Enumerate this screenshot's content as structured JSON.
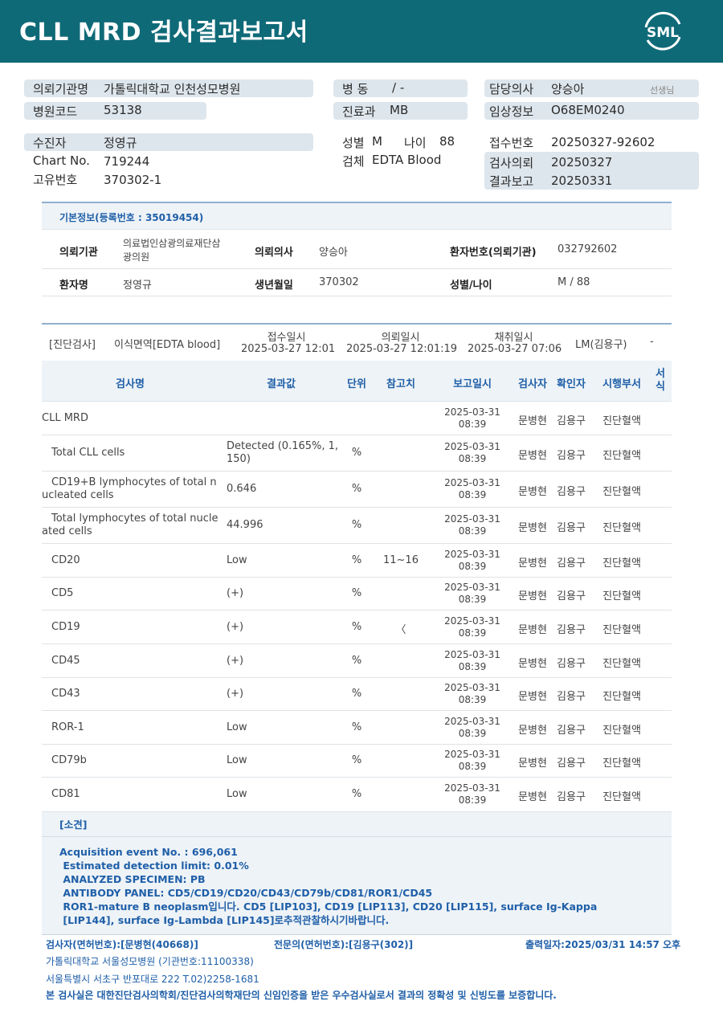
{
  "header": {
    "title": "CLL MRD 검사결과보고서",
    "logo_text": "SML"
  },
  "patient_block": {
    "req_org_label": "의뢰기관명",
    "req_org_value": "가톨릭대학교 인천성모병원",
    "hosp_code_label": "병원코드",
    "hosp_code_value": "53138",
    "ward_label": "병   동",
    "ward_value": "/ -",
    "dept_label": "진료과",
    "dept_value": "MB",
    "doctor_label": "담당의사",
    "doctor_value": "양승아",
    "doctor_suffix": "선생님",
    "clinical_label": "임상정보",
    "clinical_value": "O68EM0240",
    "patient_label": "수진자",
    "patient_value": "정영규",
    "chart_label": "Chart No.",
    "chart_value": "719244",
    "uid_label": "고유번호",
    "uid_value": "370302-1",
    "sex_label": "성별",
    "sex_value": "M",
    "age_label": "나이",
    "age_value": "88",
    "specimen_label": "검체",
    "specimen_value": "EDTA Blood",
    "receipt_label": "접수번호",
    "receipt_value": "20250327-92602",
    "request_label": "검사의뢰",
    "request_value": "20250327",
    "report_label": "결과보고",
    "report_value": "20250331"
  },
  "basic_info": {
    "title": "기본정보(등록번호 : 35019454)",
    "org_label": "의뢰기관",
    "org_value_1": "의료법인삼광의료재단삼",
    "org_value_2": "광의원",
    "doctor_label": "의뢰의사",
    "doctor_value": "양승아",
    "pid_label": "환자번호(의뢰기관)",
    "pid_value": "032792602",
    "name_label": "환자명",
    "name_value": "정영규",
    "dob_label": "생년월일",
    "dob_value": "370302",
    "sexage_label": "성별/나이",
    "sexage_value": "M / 88"
  },
  "test_info": {
    "category": "[진단검사]",
    "specimen": "이식면역[EDTA blood]",
    "receipt_label": "접수일시",
    "receipt_value": "2025-03-27 12:01",
    "request_label": "의뢰일시",
    "request_value": "2025-03-27 12:01:19",
    "collect_label": "채취일시",
    "collect_value": "2025-03-27 07:06",
    "lm": "LM(김용구)",
    "dash": "-"
  },
  "table": {
    "headers": {
      "name": "검사명",
      "result": "결과값",
      "unit": "단위",
      "ref": "참고치",
      "date": "보고일시",
      "tester": "검사자",
      "checker": "확인자",
      "dept": "시행부서",
      "form": "서식"
    },
    "rows": [
      {
        "name": "CLL MRD",
        "result": "",
        "unit": "",
        "ref": "",
        "date1": "2025-03-31",
        "date2": "08:39",
        "tester": "문병현",
        "checker": "김용구",
        "dept": "진단혈액"
      },
      {
        "name": "Total CLL cells",
        "result": "Detected (0.165%, 1,150)",
        "unit": "%",
        "ref": "",
        "date1": "2025-03-31",
        "date2": "08:39",
        "tester": "문병현",
        "checker": "김용구",
        "dept": "진단혈액"
      },
      {
        "name": "CD19+B lymphocytes of total nucleated cells",
        "result": "0.646",
        "unit": "%",
        "ref": "",
        "date1": "2025-03-31",
        "date2": "08:39",
        "tester": "문병현",
        "checker": "김용구",
        "dept": "진단혈액"
      },
      {
        "name": "Total lymphocytes of total nucleated cells",
        "result": "44.996",
        "unit": "%",
        "ref": "",
        "date1": "2025-03-31",
        "date2": "08:39",
        "tester": "문병현",
        "checker": "김용구",
        "dept": "진단혈액"
      },
      {
        "name": "CD20",
        "result": "Low",
        "unit": "%",
        "ref": "11~16",
        "date1": "2025-03-31",
        "date2": "08:39",
        "tester": "문병현",
        "checker": "김용구",
        "dept": "진단혈액"
      },
      {
        "name": "CD5",
        "result": "(+)",
        "unit": "%",
        "ref": "",
        "date1": "2025-03-31",
        "date2": "08:39",
        "tester": "문병현",
        "checker": "김용구",
        "dept": "진단혈액"
      },
      {
        "name": "CD19",
        "result": "(+)",
        "unit": "%",
        "ref": "〈",
        "date1": "2025-03-31",
        "date2": "08:39",
        "tester": "문병현",
        "checker": "김용구",
        "dept": "진단혈액"
      },
      {
        "name": "CD45",
        "result": "(+)",
        "unit": "%",
        "ref": "",
        "date1": "2025-03-31",
        "date2": "08:39",
        "tester": "문병현",
        "checker": "김용구",
        "dept": "진단혈액"
      },
      {
        "name": "CD43",
        "result": "(+)",
        "unit": "%",
        "ref": "",
        "date1": "2025-03-31",
        "date2": "08:39",
        "tester": "문병현",
        "checker": "김용구",
        "dept": "진단혈액"
      },
      {
        "name": "ROR-1",
        "result": "Low",
        "unit": "%",
        "ref": "",
        "date1": "2025-03-31",
        "date2": "08:39",
        "tester": "문병현",
        "checker": "김용구",
        "dept": "진단혈액"
      },
      {
        "name": "CD79b",
        "result": "Low",
        "unit": "%",
        "ref": "",
        "date1": "2025-03-31",
        "date2": "08:39",
        "tester": "문병현",
        "checker": "김용구",
        "dept": "진단혈액"
      },
      {
        "name": "CD81",
        "result": "Low",
        "unit": "%",
        "ref": "",
        "date1": "2025-03-31",
        "date2": "08:39",
        "tester": "문병현",
        "checker": "김용구",
        "dept": "진단혈액"
      }
    ]
  },
  "comment": {
    "title": "[소견]",
    "lines": [
      "Acquisition event No. : 696,061",
      " Estimated detection limit: 0.01%",
      " ANALYZED SPECIMEN: PB",
      " ANTIBODY PANEL: CD5/CD19/CD20/CD43/CD79b/CD81/ROR1/CD45",
      " ROR1-mature B neoplasm입니다. CD5 [LIP103], CD19 [LIP113], CD20 [LIP115], surface Ig-Kappa",
      " [LIP144], surface Ig-Lambda [LIP145]로추적관찰하시기바랍니다."
    ]
  },
  "footer": {
    "tester": "검사자(면허번호):[문병현(40668)]",
    "specialist": "전문의(면허번호):[김용구(302)]",
    "printed": "출력일자:2025/03/31 14:57 오후",
    "hospital": "가톨릭대학교 서울성모병원 (기관번호:11100338)",
    "address": "서울특별시 서초구 반포대로 222 T.02)2258-1681",
    "certification": "본 검사실은 대한진단검사의학회/진단검사의학재단의 신임인증을 받은 우수검사실로서 결과의 정확성 및 신빙도를 보증합니다."
  },
  "colors": {
    "header_bg": "#0f6a78",
    "accent_blue": "#1f5fa8",
    "label_bg": "#dde6ec"
  }
}
